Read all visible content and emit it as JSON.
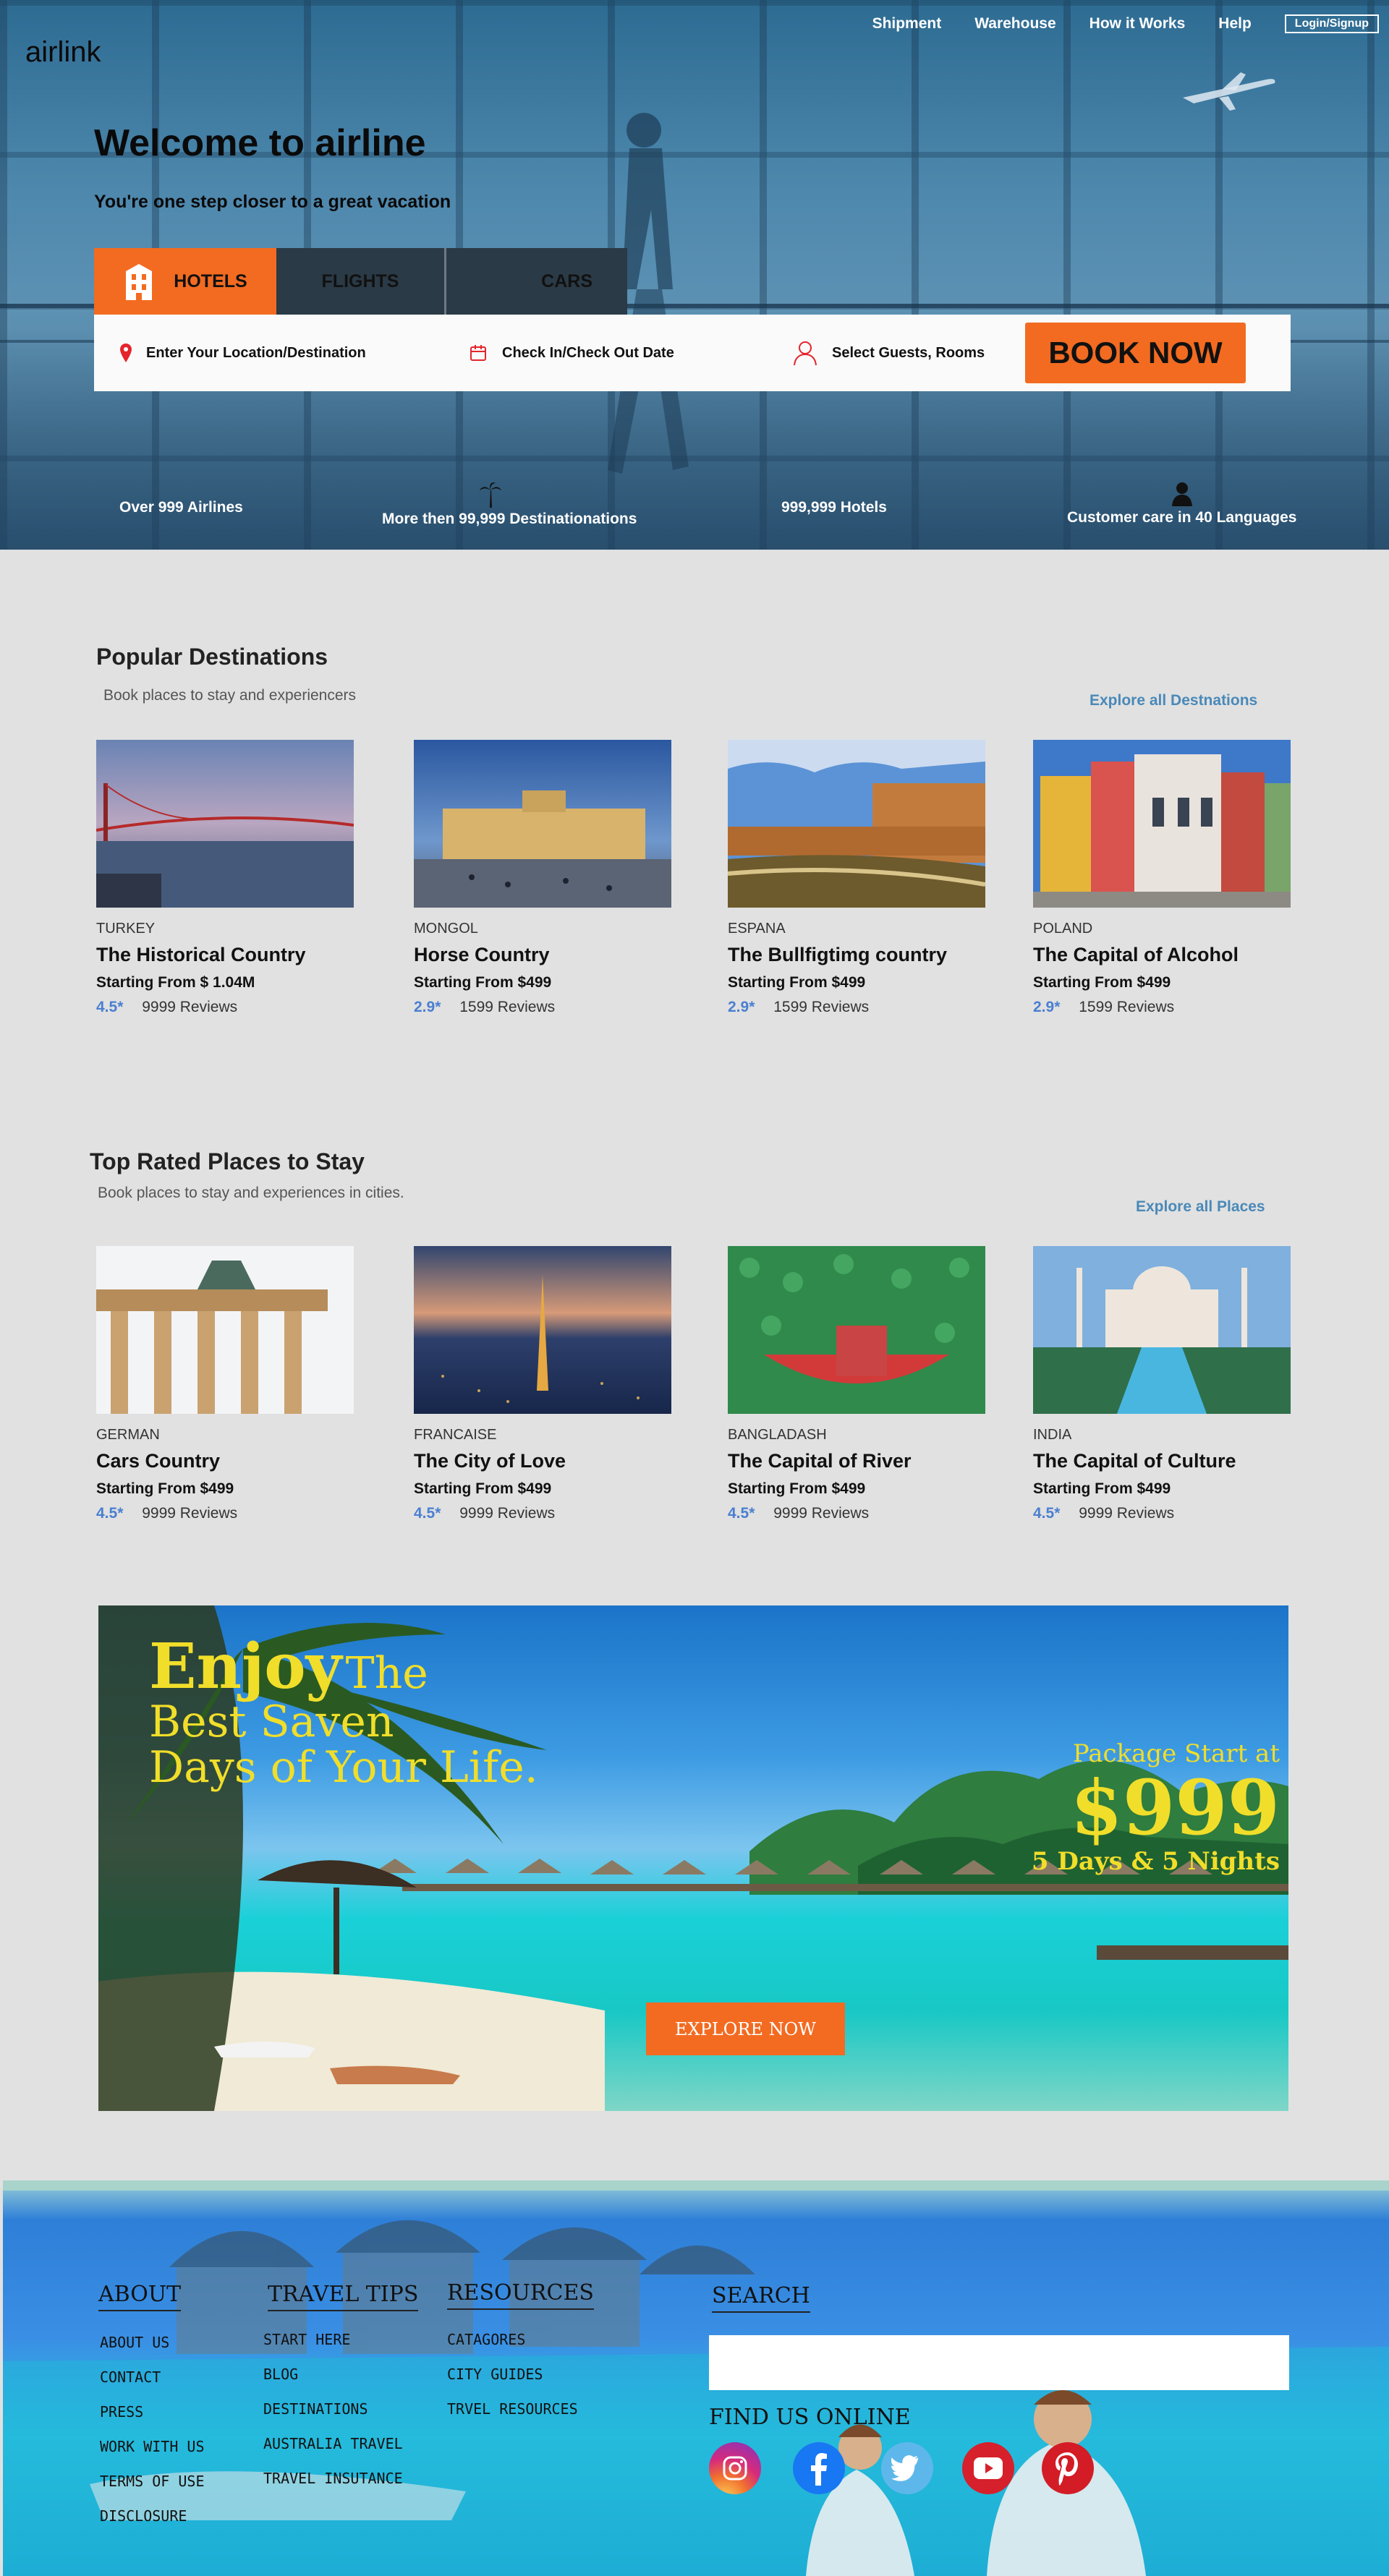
{
  "brand": "airlink",
  "nav": {
    "items": [
      "Shipment",
      "Warehouse",
      "How it Works",
      "Help"
    ],
    "login": "Login/Signup"
  },
  "hero": {
    "title": "Welcome to airline",
    "subtitle": "You're one step closer to a great vacation"
  },
  "tabs": {
    "hotels": "HOTELS",
    "flights": "FLIGHTS",
    "cars": "CARS",
    "active": "HOTELS"
  },
  "search": {
    "location": "Enter Your Location/Destination",
    "dates": "Check In/Check Out Date",
    "guests": "Select Guests, Rooms",
    "book": "BOOK NOW"
  },
  "stats": [
    "Over 999 Airlines",
    "More then 99,999  Destinationations",
    "999,999 Hotels",
    "Customer care in 40 Languages"
  ],
  "popular": {
    "title": "Popular Destinations",
    "subtitle": "Book places to stay and experiencers",
    "explore": "Explore all Destnations",
    "cards": [
      {
        "country": "TURKEY",
        "name": "The Historical Country",
        "price": "Starting From $ 1.04M",
        "rating": "4.5*",
        "reviews": "9999 Reviews"
      },
      {
        "country": "MONGOL",
        "name": "Horse Country",
        "price": "Starting From $499",
        "rating": "2.9*",
        "reviews": "1599 Reviews"
      },
      {
        "country": "ESPANA",
        "name": "The Bullfigtimg country",
        "price": "Starting From $499",
        "rating": "2.9*",
        "reviews": "1599 Reviews"
      },
      {
        "country": "POLAND",
        "name": "The Capital of Alcohol",
        "price": "Starting From $499",
        "rating": "2.9*",
        "reviews": "1599 Reviews"
      }
    ]
  },
  "toprated": {
    "title": "Top Rated Places to Stay",
    "subtitle": "Book places to stay and experiences in cities.",
    "explore": "Explore all Places",
    "cards": [
      {
        "country": "GERMAN",
        "name": "Cars Country",
        "price": "Starting From $499",
        "rating": "4.5*",
        "reviews": "9999 Reviews"
      },
      {
        "country": "FRANCAISE",
        "name": "The City of Love",
        "price": "Starting From $499",
        "rating": "4.5*",
        "reviews": "9999 Reviews"
      },
      {
        "country": "BANGLADASH",
        "name": "The Capital of River",
        "price": "Starting From $499",
        "rating": "4.5*",
        "reviews": "9999 Reviews"
      },
      {
        "country": "INDIA",
        "name": "The Capital of Culture",
        "price": "Starting From $499",
        "rating": "4.5*",
        "reviews": "9999 Reviews"
      }
    ]
  },
  "promo": {
    "line1a": "Enjoy",
    "line1b": "The",
    "line2": "Best Saven",
    "line3": "Days of Your Life.",
    "pkg_label": "Package Start at",
    "price": "$999",
    "duration": "5 Days & 5 Nights",
    "cta": "EXPLORE NOW"
  },
  "footer": {
    "about": {
      "title": "ABOUT",
      "links": [
        "ABOUT US",
        "CONTACT",
        "PRESS",
        "WORK WITH US",
        "TERMS OF USE",
        "DISCLOSURE"
      ]
    },
    "tips": {
      "title": "TRAVEL TIPS",
      "links": [
        "START HERE",
        "BLOG",
        "DESTINATIONS",
        "AUSTRALIA TRAVEL",
        "TRAVEL INSUTANCE"
      ]
    },
    "resources": {
      "title": "RESOURCES",
      "links": [
        "CATAGORES",
        "CITY GUIDES",
        "TRVEL RESOURCES"
      ]
    },
    "search_title": "SEARCH",
    "find_us": "FIND US ONLINE",
    "social": [
      "instagram-icon",
      "facebook-icon",
      "twitter-icon",
      "youtube-icon",
      "pinterest-icon"
    ]
  },
  "colors": {
    "accent": "#f26b21",
    "dark_tab": "#2a3a46",
    "link": "#4a89b8",
    "rating": "#4a7fd0",
    "promo_text": "#f1de2a"
  }
}
